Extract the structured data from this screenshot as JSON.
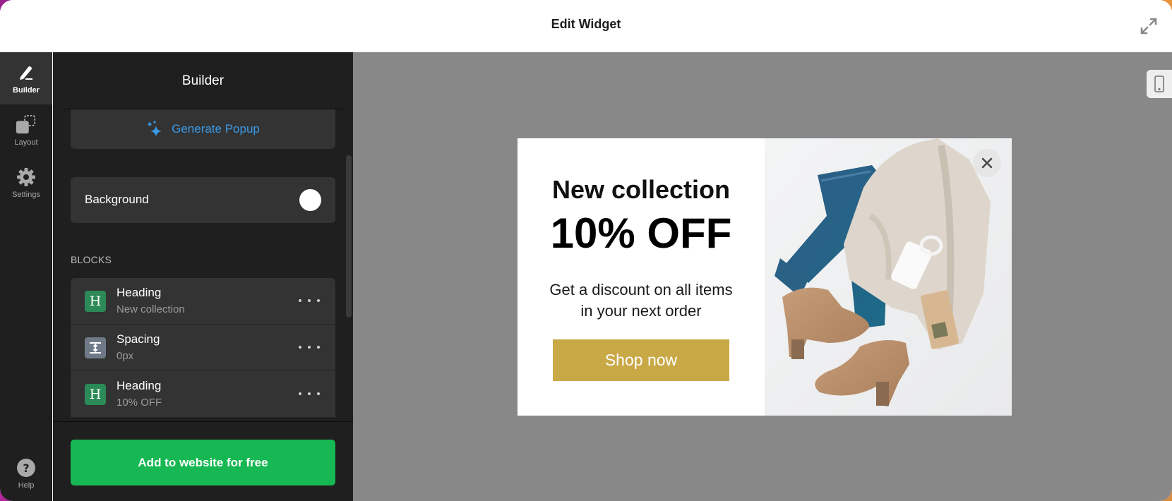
{
  "header": {
    "title": "Edit Widget",
    "expand_icon": "expand-arrows-icon"
  },
  "rail": {
    "items": [
      {
        "label": "Builder",
        "icon": "pencil-icon",
        "active": true
      },
      {
        "label": "Layout",
        "icon": "layout-icon",
        "active": false
      },
      {
        "label": "Settings",
        "icon": "gear-icon",
        "active": false
      }
    ],
    "help": {
      "label": "Help",
      "icon": "question-circle-icon"
    }
  },
  "panel": {
    "title": "Builder",
    "generate_label": "Generate Popup",
    "background_label": "Background",
    "background_color": "#ffffff",
    "blocks_label": "BLOCKS",
    "blocks": [
      {
        "type": "heading",
        "icon_glyph": "H",
        "name": "Heading",
        "value": "New collection"
      },
      {
        "type": "spacing",
        "icon_glyph": "",
        "name": "Spacing",
        "value": "0px"
      },
      {
        "type": "heading",
        "icon_glyph": "H",
        "name": "Heading",
        "value": "10% OFF"
      }
    ],
    "add_button_label": "Add to website for free"
  },
  "preview": {
    "device_icon": "mobile-phone-icon",
    "popup": {
      "heading": "New collection",
      "subheading": "10% OFF",
      "text": "Get a discount on all items in your next order",
      "button_label": "Shop now",
      "button_color": "#c9a846",
      "close_icon": "close-x-icon",
      "image_description": "Flat lay of jeans, knit sweater, mug and suede ankle boots"
    }
  },
  "colors": {
    "accent_blue": "#3a9ae6",
    "cta_green": "#17b853",
    "heading_block_green": "#2b8a57",
    "spacing_block_gray": "#6f7a89"
  }
}
